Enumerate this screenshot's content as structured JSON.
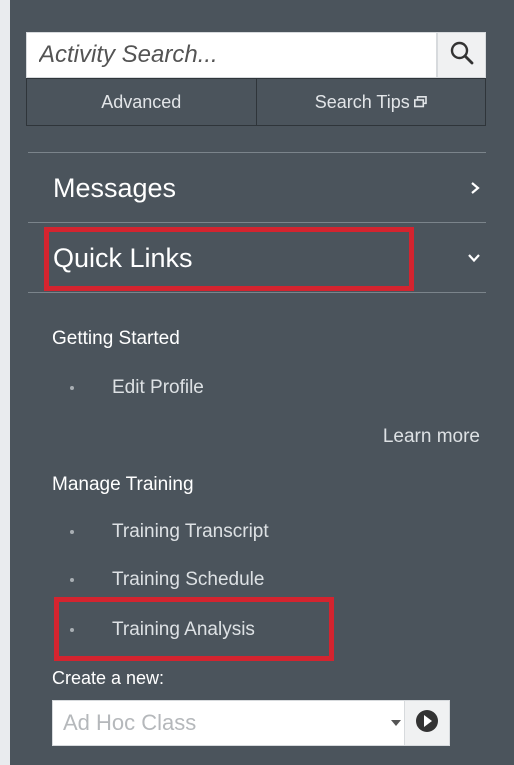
{
  "search": {
    "placeholder": "Activity Search...",
    "advanced_label": "Advanced",
    "tips_label": "Search Tips"
  },
  "menu": {
    "messages_label": "Messages",
    "quicklinks_label": "Quick Links"
  },
  "quick_links": {
    "getting_started": {
      "title": "Getting Started",
      "items": [
        {
          "label": "Edit Profile"
        }
      ],
      "learn_more": "Learn more"
    },
    "manage_training": {
      "title": "Manage Training",
      "items": [
        {
          "label": "Training Transcript"
        },
        {
          "label": "Training Schedule"
        },
        {
          "label": "Training Analysis"
        }
      ]
    }
  },
  "create": {
    "label": "Create a new:",
    "selected": "Ad Hoc Class"
  },
  "colors": {
    "panel_bg": "#4b545c",
    "highlight": "#d4242f"
  },
  "icons": {
    "search": "magnifier",
    "external": "external-link",
    "messages_chevron": "chevron-right",
    "quicklinks_chevron": "chevron-down",
    "select_caret": "caret-down",
    "go": "arrow-circle-right"
  }
}
